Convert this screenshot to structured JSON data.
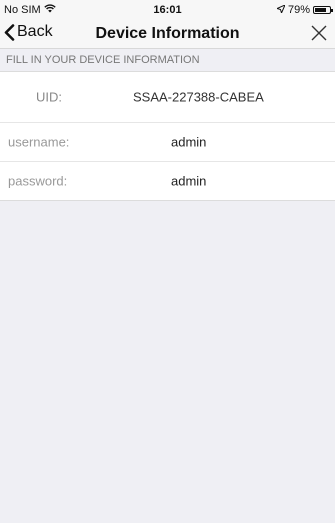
{
  "status": {
    "carrier": "No SIM",
    "time": "16:01",
    "battery": "79%",
    "battery_level": 0.79
  },
  "nav": {
    "back_label": "Back",
    "title": "Device Information"
  },
  "section": {
    "header": "FILL IN YOUR DEVICE INFORMATION"
  },
  "fields": {
    "uid": {
      "label": "UID:",
      "value": "SSAA-227388-CABEA"
    },
    "username": {
      "label": "username:",
      "value": "admin"
    },
    "password": {
      "label": "password:",
      "value": "admin"
    }
  },
  "icons": {
    "wifi": "wifi-icon",
    "location": "location-arrow-icon",
    "battery": "battery-icon",
    "back": "chevron-left-icon",
    "close": "close-icon"
  }
}
